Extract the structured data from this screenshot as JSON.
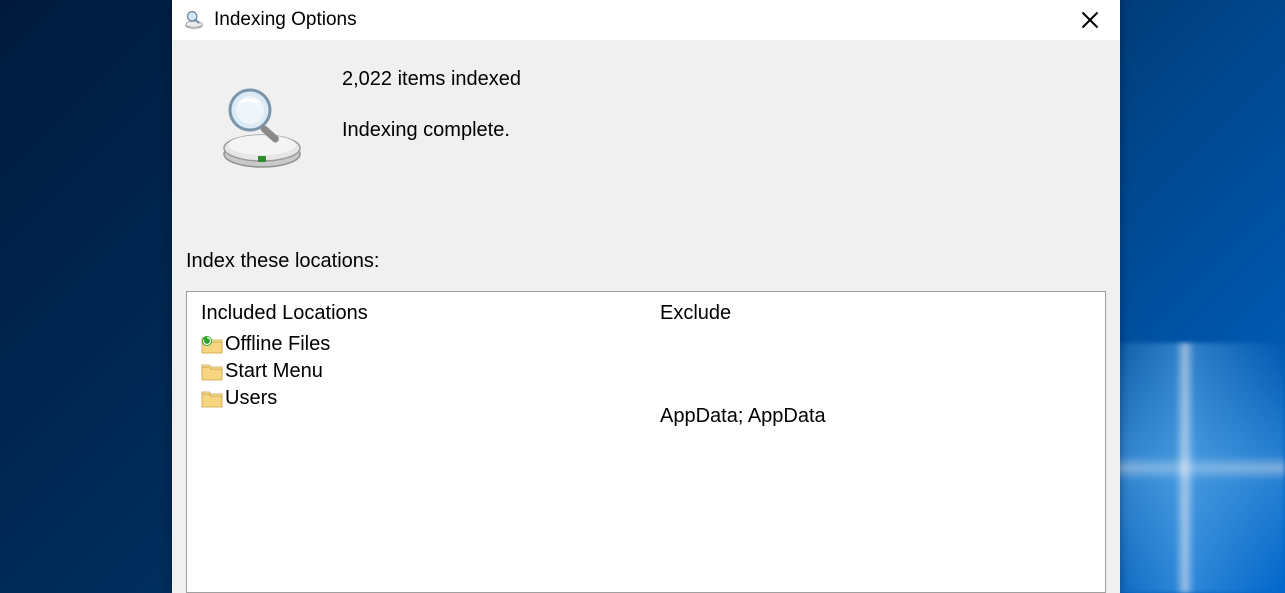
{
  "window": {
    "title": "Indexing Options"
  },
  "status": {
    "count_text": "2,022 items indexed",
    "complete_text": "Indexing complete."
  },
  "section_label": "Index these locations:",
  "columns": {
    "included_header": "Included Locations",
    "exclude_header": "Exclude"
  },
  "locations": [
    {
      "label": "Offline Files",
      "icon": "sync-folder",
      "exclude": ""
    },
    {
      "label": "Start Menu",
      "icon": "folder",
      "exclude": ""
    },
    {
      "label": "Users",
      "icon": "folder",
      "exclude": "AppData; AppData"
    }
  ]
}
